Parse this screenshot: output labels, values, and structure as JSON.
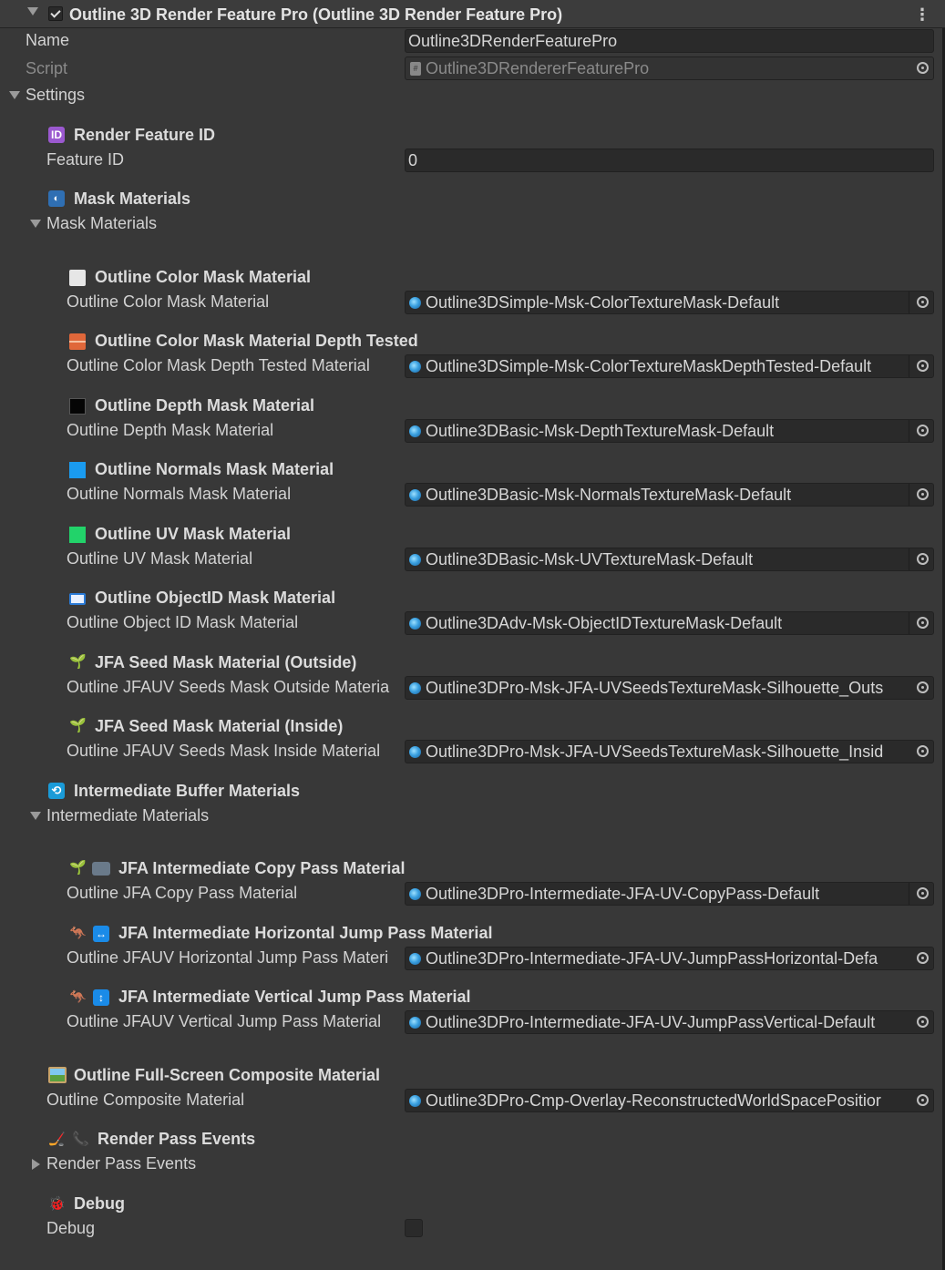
{
  "header": {
    "title": "Outline 3D Render Feature Pro (Outline 3D Render Feature Pro)",
    "enabled": true
  },
  "name_row": {
    "label": "Name",
    "value": "Outline3DRenderFeaturePro"
  },
  "script_row": {
    "label": "Script",
    "value": "Outline3DRendererFeaturePro"
  },
  "settings_label": "Settings",
  "render_feature_id": {
    "heading": "Render Feature ID",
    "label": "Feature ID",
    "value": "0"
  },
  "mask": {
    "heading": "Mask Materials",
    "foldout": "Mask Materials",
    "items": [
      {
        "heading": "Outline Color Mask Material",
        "label": "Outline Color Mask Material",
        "value": "Outline3DSimple-Msk-ColorTextureMask-Default"
      },
      {
        "heading": "Outline Color Mask Material Depth Tested",
        "label": "Outline Color Mask Depth Tested Material",
        "value": "Outline3DSimple-Msk-ColorTextureMaskDepthTested-Default"
      },
      {
        "heading": "Outline Depth Mask Material",
        "label": "Outline Depth Mask Material",
        "value": "Outline3DBasic-Msk-DepthTextureMask-Default"
      },
      {
        "heading": "Outline Normals Mask Material",
        "label": "Outline Normals Mask Material",
        "value": "Outline3DBasic-Msk-NormalsTextureMask-Default"
      },
      {
        "heading": "Outline UV Mask Material",
        "label": "Outline UV Mask Material",
        "value": "Outline3DBasic-Msk-UVTextureMask-Default"
      },
      {
        "heading": "Outline ObjectID Mask Material",
        "label": "Outline Object ID Mask Material",
        "value": "Outline3DAdv-Msk-ObjectIDTextureMask-Default"
      },
      {
        "heading": "JFA Seed Mask Material (Outside)",
        "label": "Outline JFAUV Seeds Mask Outside Materia",
        "value": "Outline3DPro-Msk-JFA-UVSeedsTextureMask-Silhouette_Outs"
      },
      {
        "heading": "JFA Seed Mask Material (Inside)",
        "label": "Outline JFAUV Seeds Mask Inside Material",
        "value": "Outline3DPro-Msk-JFA-UVSeedsTextureMask-Silhouette_Insid"
      }
    ]
  },
  "intermediate": {
    "heading": "Intermediate Buffer Materials",
    "foldout": "Intermediate Materials",
    "items": [
      {
        "heading": "JFA Intermediate Copy Pass Material",
        "label": "Outline JFA Copy Pass Material",
        "value": "Outline3DPro-Intermediate-JFA-UV-CopyPass-Default"
      },
      {
        "heading": "JFA Intermediate Horizontal Jump Pass Material",
        "label": "Outline JFAUV Horizontal Jump Pass Materi",
        "value": "Outline3DPro-Intermediate-JFA-UV-JumpPassHorizontal-Defa"
      },
      {
        "heading": "JFA Intermediate Vertical Jump Pass Material",
        "label": "Outline JFAUV Vertical Jump Pass Material",
        "value": "Outline3DPro-Intermediate-JFA-UV-JumpPassVertical-Default"
      }
    ]
  },
  "composite": {
    "heading": "Outline Full-Screen Composite Material",
    "label": "Outline Composite Material",
    "value": "Outline3DPro-Cmp-Overlay-ReconstructedWorldSpacePositior"
  },
  "render_pass": {
    "heading": "Render Pass Events",
    "foldout": "Render Pass Events"
  },
  "debug": {
    "heading": "Debug",
    "label": "Debug",
    "checked": false
  },
  "icons": [
    "id-icon",
    "mask-icon",
    "white-square-icon",
    "brick-icon",
    "black-square-icon",
    "blue-square-icon",
    "green-square-icon",
    "id-card-icon",
    "seedling-icon",
    "camera-icon",
    "kangaroo-icon",
    "left-right-arrow-icon",
    "up-down-arrow-icon",
    "refresh-icon",
    "picture-icon",
    "hockey-icon",
    "telephone-icon",
    "ladybug-icon"
  ]
}
